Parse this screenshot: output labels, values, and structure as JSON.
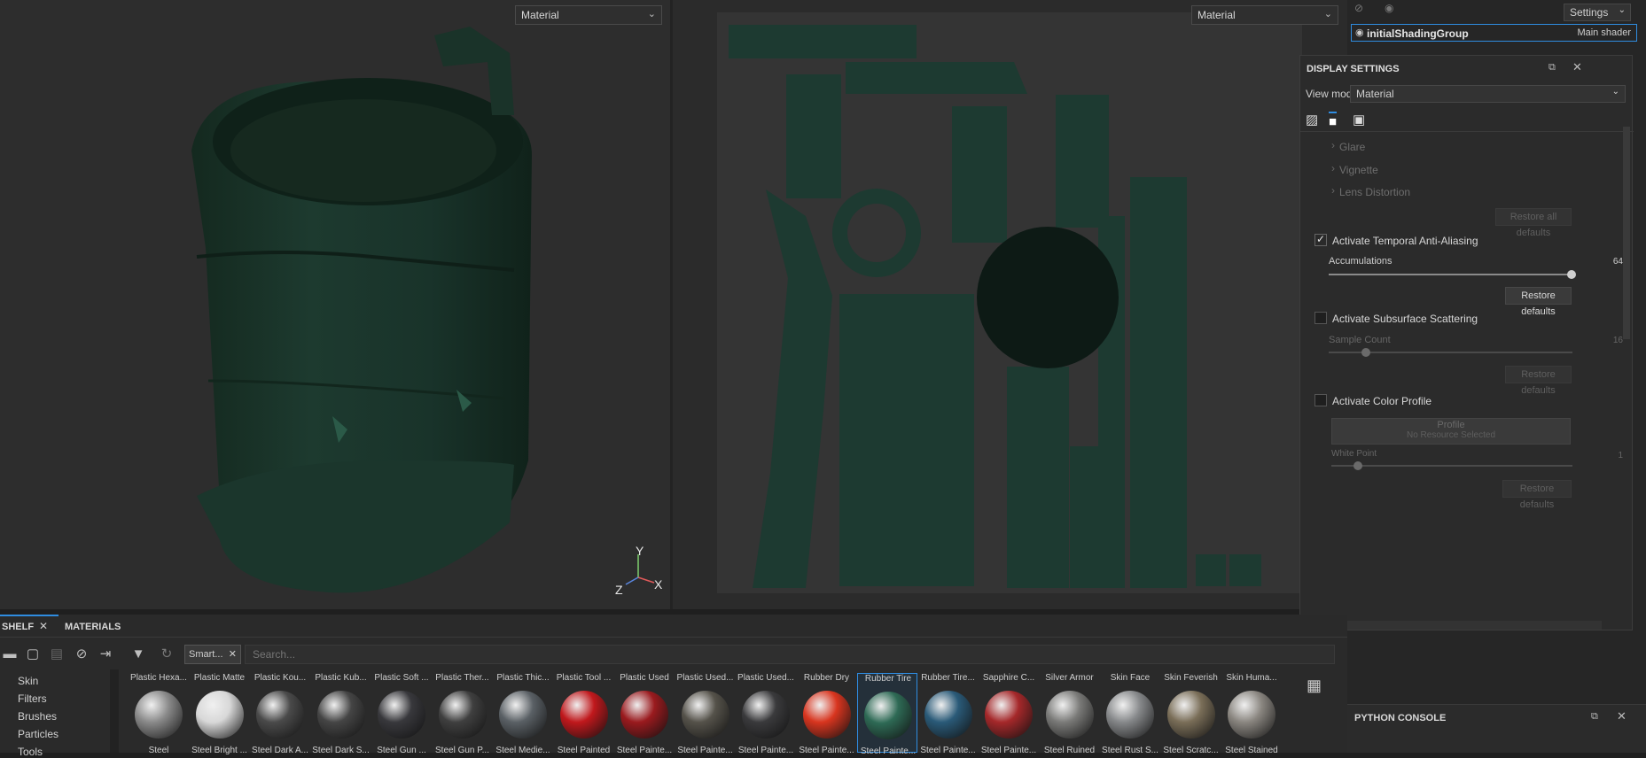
{
  "viewport3d": {
    "mode": "Material",
    "axes": {
      "y": "Y",
      "x": "X",
      "z": "Z"
    }
  },
  "viewport2d": {
    "mode": "Material"
  },
  "top_right": {
    "settings_label": "Settings"
  },
  "layer": {
    "name": "initialShadingGroup",
    "shader": "Main shader"
  },
  "display_settings": {
    "title": "DISPLAY SETTINGS",
    "view_mode_label": "View mode",
    "view_mode_value": "Material",
    "effects": [
      "Glare",
      "Vignette",
      "Lens Distortion"
    ],
    "restore_all": "Restore all defaults",
    "taa": {
      "label": "Activate Temporal Anti-Aliasing",
      "checked": true,
      "accum_label": "Accumulations",
      "accum_value": "64",
      "accum_level": 1.0,
      "restore": "Restore defaults"
    },
    "sss": {
      "label": "Activate Subsurface Scattering",
      "checked": false,
      "count_label": "Sample Count",
      "count_value": "16",
      "count_level": 0.03,
      "restore": "Restore defaults"
    },
    "color_profile": {
      "label": "Activate Color Profile",
      "checked": false,
      "profile_label": "Profile",
      "profile_value": "No Resource Selected",
      "white_label": "White Point",
      "white_value": "1",
      "white_level": 0.11,
      "restore": "Restore defaults"
    }
  },
  "python_console": {
    "title": "PYTHON CONSOLE"
  },
  "shelf": {
    "tabs": [
      "SHELF",
      "MATERIALS"
    ],
    "filter_chip": "Smart...",
    "search_placeholder": "Search...",
    "categories": [
      "Skin",
      "Filters",
      "Brushes",
      "Particles",
      "Tools"
    ],
    "materials": [
      {
        "top": "Plastic Hexa...",
        "bottom": "Steel",
        "color": "#8a8a8a"
      },
      {
        "top": "Plastic Matte",
        "bottom": "Steel Bright ...",
        "color": "#d8d8d8"
      },
      {
        "top": "Plastic Kou...",
        "bottom": "Steel Dark A...",
        "color": "#4a4a4a"
      },
      {
        "top": "Plastic Kub...",
        "bottom": "Steel Dark S...",
        "color": "#454545"
      },
      {
        "top": "Plastic Soft ...",
        "bottom": "Steel Gun ...",
        "color": "#38383c"
      },
      {
        "top": "Plastic Ther...",
        "bottom": "Steel Gun P...",
        "color": "#3f3f3f"
      },
      {
        "top": "Plastic Thic...",
        "bottom": "Steel Medie...",
        "color": "#5a6065"
      },
      {
        "top": "Plastic Tool ...",
        "bottom": "Steel Painted",
        "color": "#c0181c"
      },
      {
        "top": "Plastic Used",
        "bottom": "Steel Painte...",
        "color": "#9a1a1e"
      },
      {
        "top": "Plastic Used...",
        "bottom": "Steel Painte...",
        "color": "#55524a"
      },
      {
        "top": "Plastic Used...",
        "bottom": "Steel Painte...",
        "color": "#3a3a3c"
      },
      {
        "top": "Rubber Dry",
        "bottom": "Steel Painte...",
        "color": "#d8351f"
      },
      {
        "top": "Rubber Tire",
        "bottom": "Steel Painte...",
        "color": "#2e6a55"
      },
      {
        "top": "Rubber Tire...",
        "bottom": "Steel Painte...",
        "color": "#2a5a78"
      },
      {
        "top": "Sapphire C...",
        "bottom": "Steel Painte...",
        "color": "#a5282a"
      },
      {
        "top": "Silver Armor",
        "bottom": "Steel Ruined",
        "color": "#7a7a78"
      },
      {
        "top": "Skin Face",
        "bottom": "Steel Rust S...",
        "color": "#86888a"
      },
      {
        "top": "Skin Feverish",
        "bottom": "Steel Scratc...",
        "color": "#7a6e58"
      },
      {
        "top": "Skin Huma...",
        "bottom": "Steel Stained",
        "color": "#8a8680"
      }
    ],
    "selected_index": 12
  },
  "colors": {
    "accent": "#2f8ce0",
    "green_mesh": "#1f3a32"
  }
}
